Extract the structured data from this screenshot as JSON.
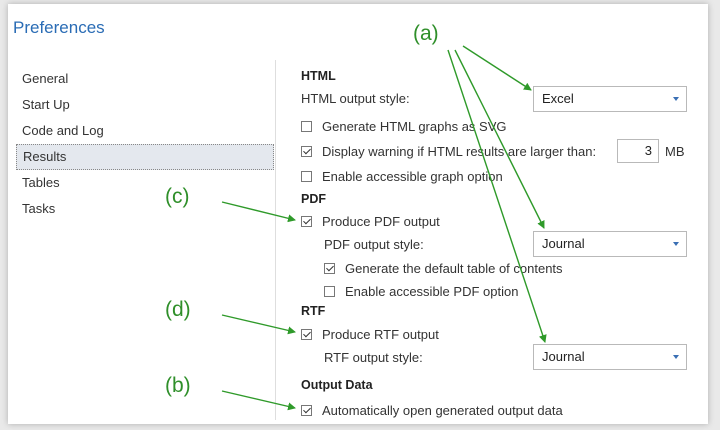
{
  "dialog": {
    "title": "Preferences"
  },
  "sidebar": {
    "items": [
      {
        "label": "General"
      },
      {
        "label": "Start Up"
      },
      {
        "label": "Code and Log"
      },
      {
        "label": "Results",
        "selected": true
      },
      {
        "label": "Tables"
      },
      {
        "label": "Tasks"
      }
    ]
  },
  "html": {
    "heading": "HTML",
    "style_label": "HTML output style:",
    "style_value": "Excel",
    "svg_label": "Generate HTML graphs as SVG",
    "svg_checked": false,
    "warn_label": "Display warning if HTML results are larger than:",
    "warn_checked": true,
    "warn_value": "3",
    "warn_unit": "MB",
    "accessible_label": "Enable accessible graph option",
    "accessible_checked": false
  },
  "pdf": {
    "heading": "PDF",
    "produce_label": "Produce PDF output",
    "produce_checked": true,
    "style_label": "PDF output style:",
    "style_value": "Journal",
    "toc_label": "Generate the default table of contents",
    "toc_checked": true,
    "accessible_label": "Enable accessible PDF option",
    "accessible_checked": false
  },
  "rtf": {
    "heading": "RTF",
    "produce_label": "Produce RTF output",
    "produce_checked": true,
    "style_label": "RTF output style:",
    "style_value": "Journal"
  },
  "output_data": {
    "heading": "Output Data",
    "auto_open_label": "Automatically open generated output data",
    "auto_open_checked": true
  },
  "annotations": {
    "a": "(a)",
    "b": "(b)",
    "c": "(c)",
    "d": "(d)",
    "color": "#2f9a2a"
  }
}
